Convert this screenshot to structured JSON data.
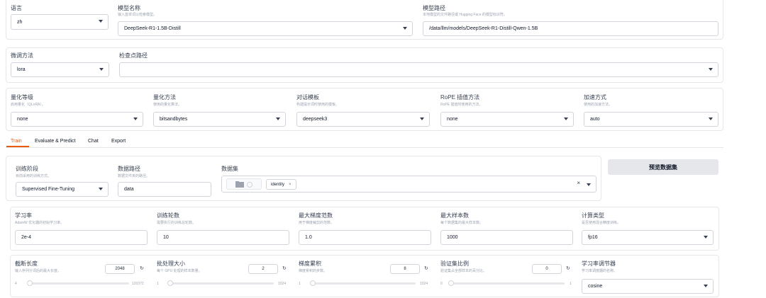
{
  "top": {
    "language": {
      "label": "语言",
      "value": "zh"
    },
    "model_name": {
      "label": "模型名称",
      "hint": "输入首单词以检索模型。",
      "value": "DeepSeek-R1-1.5B-Distill"
    },
    "model_path": {
      "label": "模型路径",
      "hint": "本地模型的文件路径或 Hugging Face 的模型标识符。",
      "value": "/data/llm/models/DeepSeek-R1-Distill-Qwen-1.5B"
    }
  },
  "finetune": {
    "method": {
      "label": "微调方法",
      "value": "lora"
    },
    "checkpoint": {
      "label": "检查点路径",
      "value": ""
    }
  },
  "quant_row": {
    "quant_bit": {
      "label": "量化等级",
      "hint": "启用量化（QLoRA）。",
      "value": "none"
    },
    "quant_method": {
      "label": "量化方法",
      "hint": "使用的量化算法。",
      "value": "bitsandbytes"
    },
    "template": {
      "label": "对话模板",
      "hint": "构建提示词时使用的模板。",
      "value": "deepseek3"
    },
    "rope": {
      "label": "RoPE 插值方法",
      "hint": "RoPE 插值时使用的方法。",
      "value": "none"
    },
    "booster": {
      "label": "加速方式",
      "hint": "使用的加速方法。",
      "value": "auto"
    }
  },
  "tabs": [
    "Train",
    "Evaluate & Predict",
    "Chat",
    "Export"
  ],
  "train": {
    "stage": {
      "label": "训练阶段",
      "hint": "目前采用的训练方式。",
      "value": "Supervised Fine-Tuning"
    },
    "dataset_dir": {
      "label": "数据路径",
      "hint": "数据文件夹的路径。",
      "value": "data"
    },
    "dataset": {
      "label": "数据集",
      "tag": "identity",
      "tag_close": "×",
      "clear": "×"
    },
    "preview_button": "预览数据集"
  },
  "hparams": {
    "learning_rate": {
      "label": "学习率",
      "hint": "AdamW 优化器的初始学习率。",
      "value": "2e-4"
    },
    "epochs": {
      "label": "训练轮数",
      "hint": "需要执行的训练总轮数。",
      "value": "10"
    },
    "max_grad_norm": {
      "label": "最大梯度范数",
      "hint": "用于梯度裁剪的范数。",
      "value": "1.0"
    },
    "max_samples": {
      "label": "最大样本数",
      "hint": "每个数据集的最大样本数。",
      "value": "1000"
    },
    "compute_type": {
      "label": "计算类型",
      "hint": "是否使用混合精度训练。",
      "value": "fp16"
    }
  },
  "sliders": {
    "cutoff_len": {
      "label": "截断长度",
      "hint": "输入序列分词后的最大长度。",
      "value": "2048",
      "min": "4",
      "max": "131072",
      "fraction": 0.0156
    },
    "batch_size": {
      "label": "批处理大小",
      "hint": "每个 GPU 处理的样本数量。",
      "value": "2",
      "min": "1",
      "max": "1024",
      "fraction": 0.001
    },
    "grad_accum": {
      "label": "梯度累积",
      "hint": "梯度累积的步数。",
      "value": "8",
      "min": "1",
      "max": "1024",
      "fraction": 0.007
    },
    "val_size": {
      "label": "验证集比例",
      "hint": "验证集占全部样本的百分比。",
      "value": "0",
      "min": "0",
      "max": "1",
      "fraction": 0.0
    },
    "lr_scheduler": {
      "label": "学习率调节器",
      "hint": "学习率调度器的名称。",
      "value": "cosine"
    }
  },
  "icons": {
    "reset": "↻",
    "caret": "chevron-down",
    "folder": "folder-icon"
  },
  "colors": {
    "accent": "#ea580c",
    "button_bg": "#e5e7eb",
    "slider_accent": "#f97316"
  }
}
